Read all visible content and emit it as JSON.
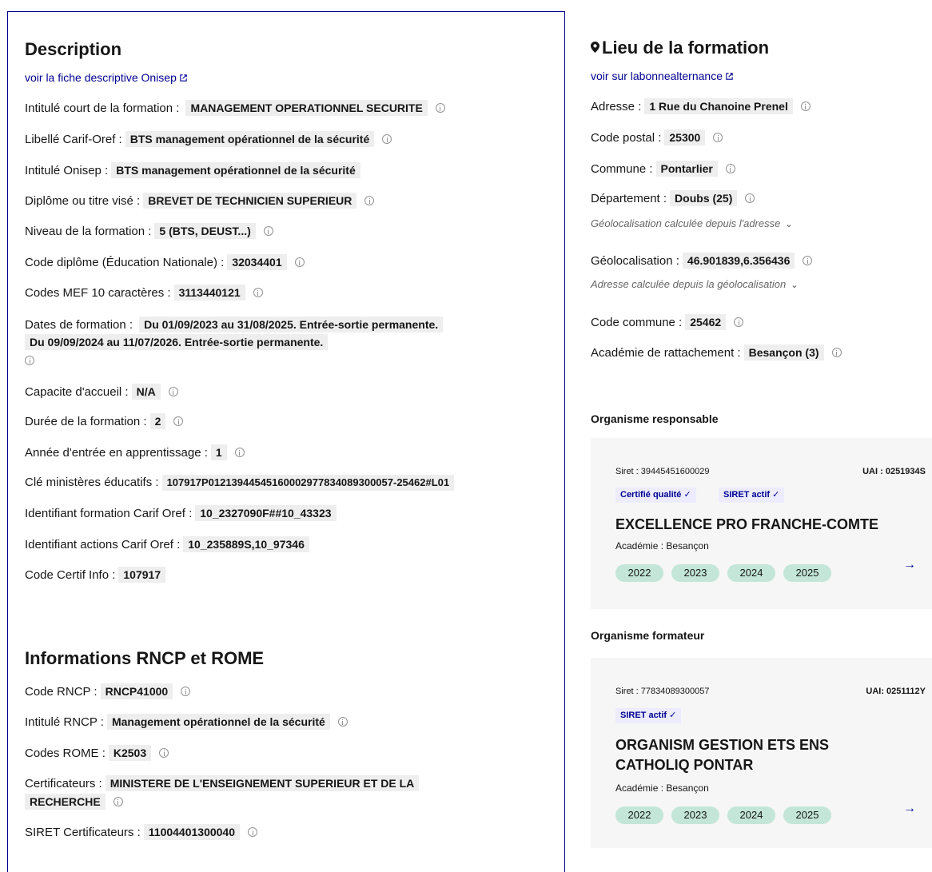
{
  "description": {
    "title": "Description",
    "link": "voir la fiche descriptive Onisep",
    "rows": [
      {
        "label": "Intitulé court de la formation :",
        "value": "MANAGEMENT OPERATIONNEL SECURITE"
      },
      {
        "label": "Libellé Carif-Oref :",
        "value": "BTS management opérationnel de la sécurité"
      },
      {
        "label": "Intitulé Onisep :",
        "value": "BTS management opérationnel de la sécurité"
      },
      {
        "label": "Diplôme ou titre visé :",
        "value": "BREVET DE TECHNICIEN SUPERIEUR"
      },
      {
        "label": "Niveau de la formation :",
        "value": "5 (BTS, DEUST...)"
      },
      {
        "label": "Code diplôme (Éducation Nationale) :",
        "value": "32034401"
      },
      {
        "label": "Codes MEF 10 caractères :",
        "value": "3113440121"
      },
      {
        "label": "Dates de formation :",
        "value": "Du 01/09/2023 au 31/08/2025. Entrée-sortie permanente.",
        "value2": "Du 09/09/2024 au 11/07/2026. Entrée-sortie permanente."
      },
      {
        "label": "Capacite d'accueil :",
        "value": "N/A"
      },
      {
        "label": "Durée de la formation :",
        "value": "2"
      },
      {
        "label": "Année d'entrée en apprentissage :",
        "value": "1"
      },
      {
        "label": "Clé ministères éducatifs :",
        "value": "107917P01213944545160002977834089300057-25462#L01"
      },
      {
        "label": "Identifiant formation Carif Oref :",
        "value": "10_2327090F##10_43323"
      },
      {
        "label": "Identifiant actions Carif Oref :",
        "value": "10_235889S,10_97346"
      },
      {
        "label": "Code Certif Info :",
        "value": "107917"
      }
    ]
  },
  "rncp": {
    "title": "Informations RNCP et ROME",
    "rows": [
      {
        "label": "Code RNCP :",
        "value": "RNCP41000"
      },
      {
        "label": "Intitulé RNCP :",
        "value": "Management opérationnel de la sécurité"
      },
      {
        "label": "Codes ROME :",
        "value": "K2503"
      },
      {
        "label": "Certificateurs :",
        "value": "MINISTERE DE L'ENSEIGNEMENT SUPERIEUR ET DE LA",
        "value2": "RECHERCHE"
      },
      {
        "label": "SIRET Certificateurs :",
        "value": "11004401300040"
      }
    ]
  },
  "lieu": {
    "title": "Lieu de la formation",
    "link": "voir sur labonnealternance",
    "rows": [
      {
        "label": "Adresse :",
        "value": "1 Rue du Chanoine Prenel"
      },
      {
        "label": "Code postal :",
        "value": "25300"
      },
      {
        "label": "Commune :",
        "value": "Pontarlier"
      },
      {
        "label": "Département :",
        "value": "Doubs (25)"
      },
      {
        "label": "Géolocalisation :",
        "value": "46.901839,6.356436"
      },
      {
        "label": "Code commune :",
        "value": "25462"
      },
      {
        "label": "Académie de rattachement :",
        "value": "Besançon (3)"
      }
    ],
    "geo_note": "Géolocalisation calculée depuis l'adresse",
    "addr_note": "Adresse calculée depuis la géolocalisation"
  },
  "responsable": {
    "section_title": "Organisme responsable",
    "siret": "Siret : 39445451600029",
    "uai": "UAI : 0251934S",
    "badges": [
      "Certifié qualité ✓",
      "SIRET actif ✓"
    ],
    "name": "EXCELLENCE PRO FRANCHE-COMTE",
    "academie": "Académie : Besançon",
    "years": [
      "2022",
      "2023",
      "2024",
      "2025"
    ]
  },
  "formateur": {
    "section_title": "Organisme formateur",
    "siret": "Siret : 77834089300057",
    "uai": "UAI: 0251112Y",
    "badges": [
      "SIRET actif ✓"
    ],
    "name_line1": "ORGANISM GESTION ETS ENS",
    "name_line2": "CATHOLIQ PONTAR",
    "academie": "Académie : Besançon",
    "years": [
      "2022",
      "2023",
      "2024",
      "2025"
    ]
  },
  "colors": {
    "link": "#000091",
    "badge_bg": "#ececfe",
    "year_bg": "#c3e6d8",
    "card_bg": "#f6f6f6"
  }
}
